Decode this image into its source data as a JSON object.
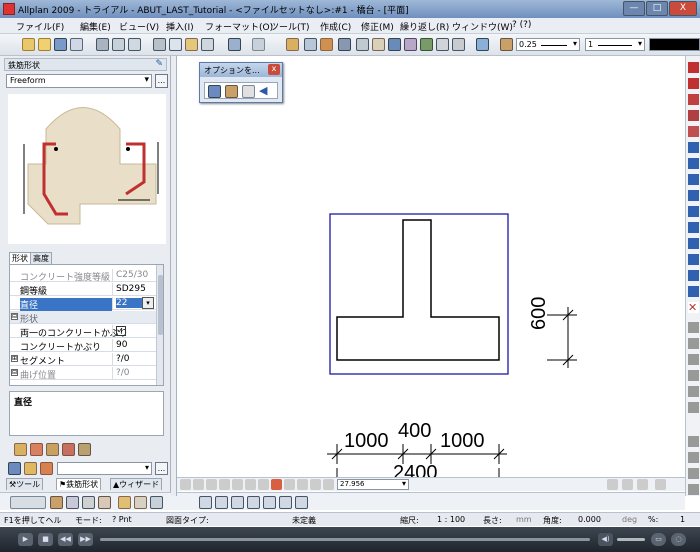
{
  "window": {
    "title": "Allplan 2009 - トライアル - ABUT_LAST_Tutorial - <ファイルセットなし>:#1 - 橋台 - [平面]",
    "min_label": "—",
    "max_label": "□",
    "close_label": "X"
  },
  "menu": [
    "ファイル(F)",
    "編集(E)",
    "ビュー(V)",
    "挿入(I)",
    "フォーマット(O)",
    "ツール(T)",
    "作成(C)",
    "修正(M)",
    "繰り返し(R)",
    "ウィンドウ(W)",
    "? (?)"
  ],
  "toolbar": {
    "pen_value": "0.25",
    "line_value": "1"
  },
  "left_panel": {
    "title": "鉄筋形状",
    "shape_select": "Freeform",
    "more_button": "...",
    "tabs": [
      "形状",
      "高度"
    ],
    "properties": [
      {
        "key": "コンクリート強度等級",
        "value": "C25/30",
        "disabled": true
      },
      {
        "key": "鋼等級",
        "value": "SD295",
        "disabled": false
      },
      {
        "key": "直径",
        "value": "22",
        "selected": true
      },
      {
        "key": "形状",
        "section": true,
        "toggle": "⊟"
      },
      {
        "key": "両一のコンクリートかぶり",
        "value": "✓"
      },
      {
        "key": "コンクリートかぶり",
        "value": "90"
      },
      {
        "key": "セグメント",
        "value": "?/0",
        "toggle": "⊞"
      },
      {
        "key": "曲げ位置",
        "value": "?/0",
        "toggle": "⊟"
      }
    ],
    "description_label": "直径",
    "bottom_tabs": [
      "ツール",
      "鉄筋形状",
      "ウィザード"
    ]
  },
  "options_dialog": {
    "title": "オプションを...",
    "close": "x"
  },
  "drawing": {
    "dim_600": "600",
    "dim_1000_left": "1000",
    "dim_400": "400",
    "dim_1000_right": "1000",
    "dim_2400": "2400"
  },
  "view_toolbar": {
    "zoom_value": "27.956"
  },
  "status": {
    "help": "F1を押してヘル",
    "mode_label": "モード:",
    "mode_value": "? Pnt",
    "type_label": "図面タイプ:",
    "type_value": "未定義",
    "scale_label": "縮尺:",
    "scale_value": "1 : 100",
    "length_label": "長さ:",
    "length_unit": "mm",
    "angle_label": "角度:",
    "angle_value": "0.000",
    "angle_unit": "deg",
    "percent_label": "%:",
    "percent_value": "1"
  }
}
